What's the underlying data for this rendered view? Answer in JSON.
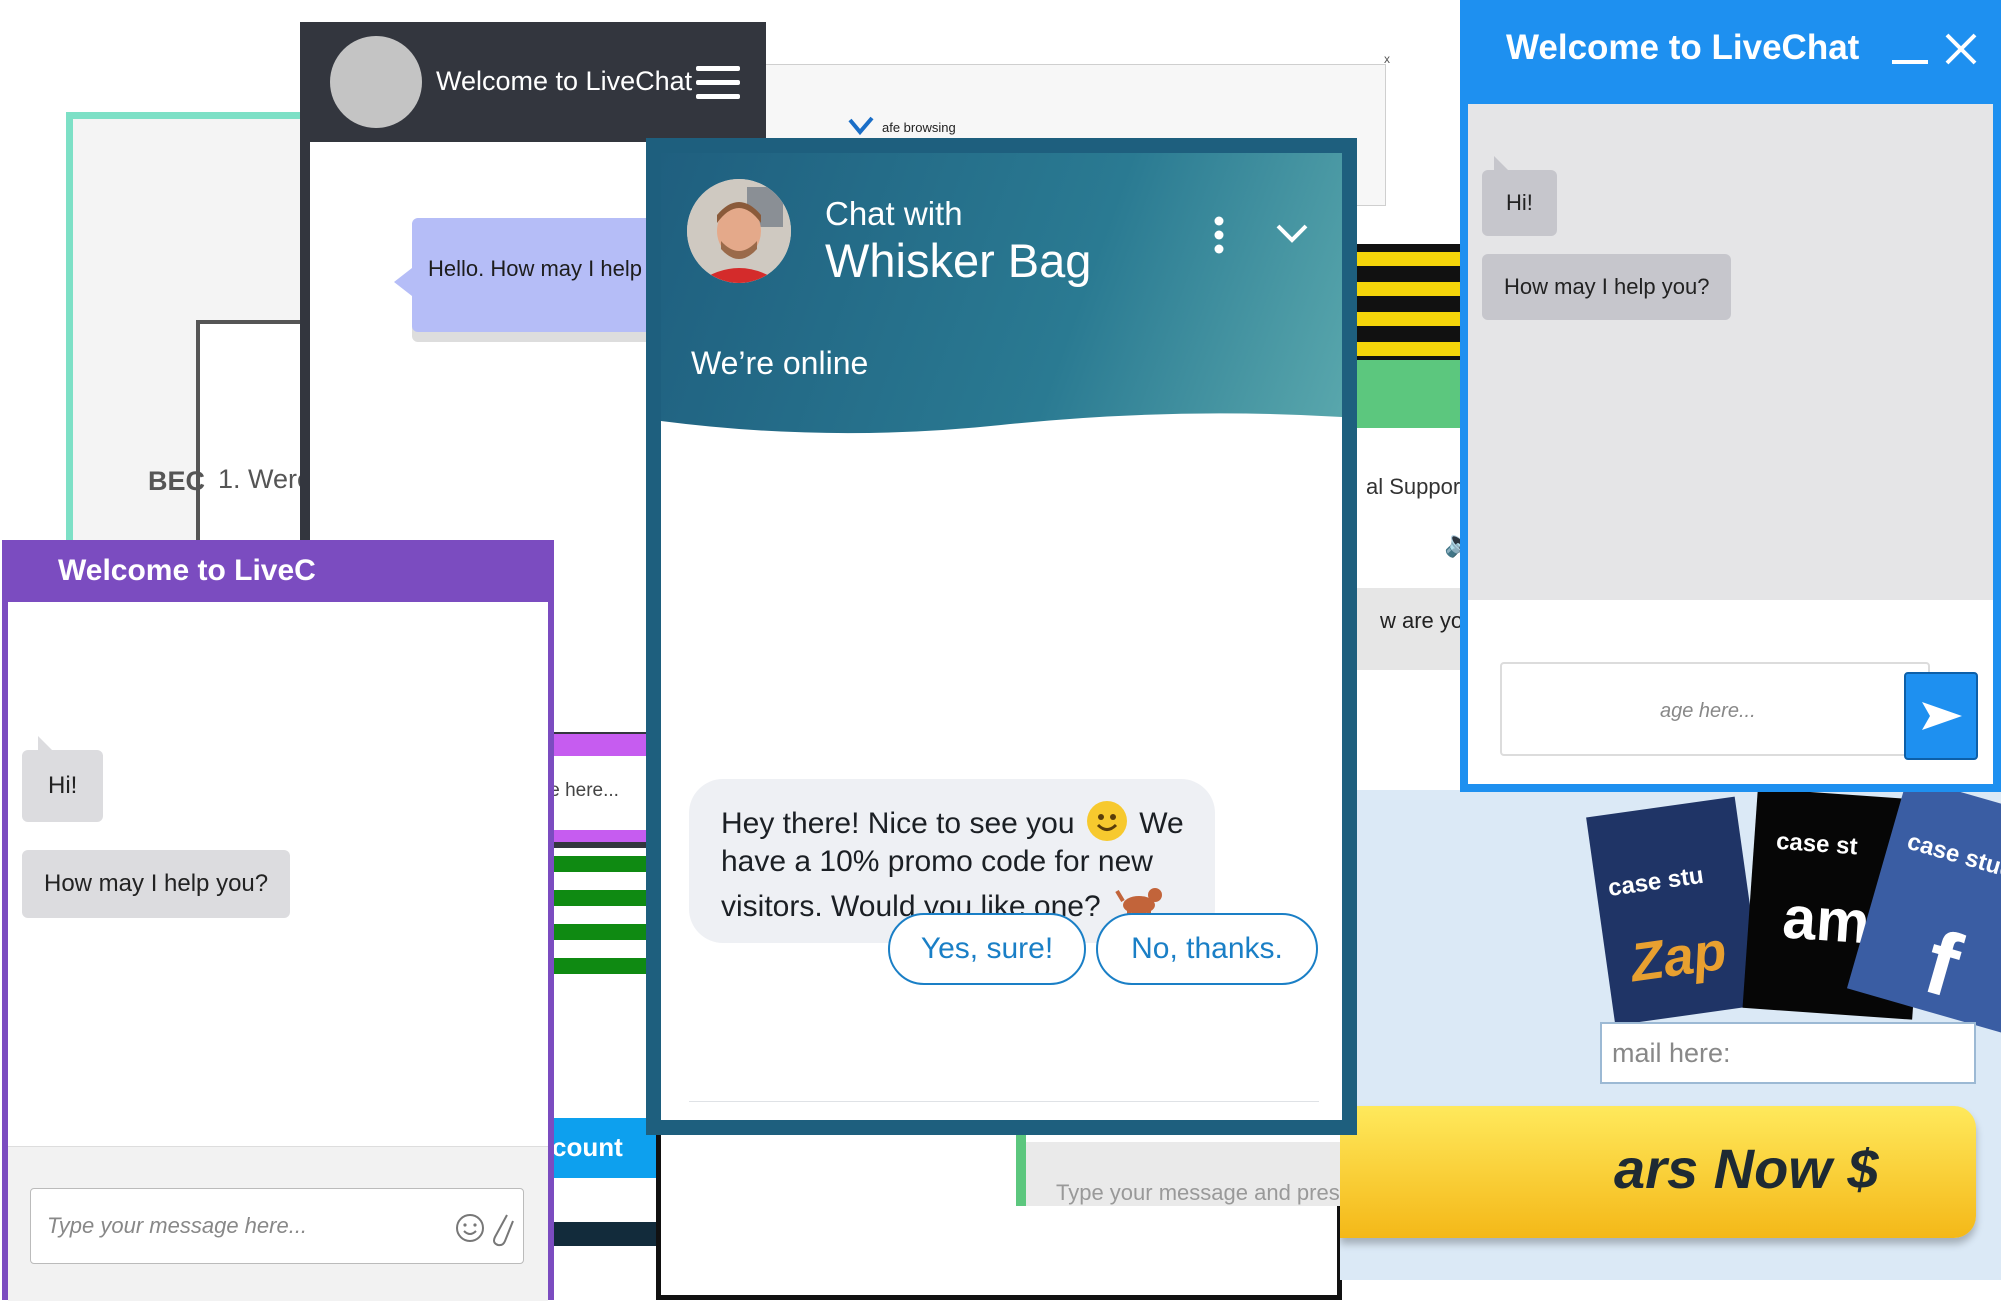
{
  "widgets": {
    "teal": {
      "partial_title": "BEC",
      "partial_item": "1. Were"
    },
    "gray": {
      "title": "Welcome to LiveChat",
      "greeting": "Hello. How may I help",
      "placeholder": "Type your message here..."
    },
    "popup": {
      "partial_text": "afe browsing",
      "close": "x"
    },
    "purple": {
      "title": "Welcome to LiveC",
      "msg1": "Hi!",
      "msg2": "How may I help you?",
      "placeholder": "Type your message here..."
    },
    "blue": {
      "title": "Welcome to LiveChat",
      "msg1": "Hi!",
      "msg2": "How may I help you?",
      "placeholder": "age here..."
    },
    "green": {
      "partial_title": "al Support",
      "partial_msg": "w are you",
      "input_hint": "Type your message and press Enter to send"
    },
    "ad": {
      "cards": [
        "case stu",
        "case st",
        "case study"
      ],
      "brands": [
        "Zap",
        "am"
      ],
      "email_placeholder": "mail here:",
      "cta": "ars Now $"
    },
    "account_button": "count"
  },
  "main_chat": {
    "header_pre": "Chat with",
    "header_name": "Whisker Bag",
    "status": "We’re online",
    "message": "Hey there! Nice to see you 🙂 We have a 10% promo code for new visitors. Would you like one? 🐕",
    "message_line1": "Hey there! Nice to see you",
    "message_line1b": "We",
    "message_line2": "have a 10% promo code for new",
    "message_line3": "visitors. Would you like one?",
    "btn_yes": "Yes, sure!",
    "btn_no": "No, thanks."
  },
  "colors": {
    "main_frame": "#1e5f7e",
    "accent_blue": "#1a7fc6",
    "livechat_blue": "#1e90f0",
    "purple": "#7b4cc0",
    "green": "#5cc77e",
    "teal": "#7de0c6"
  }
}
